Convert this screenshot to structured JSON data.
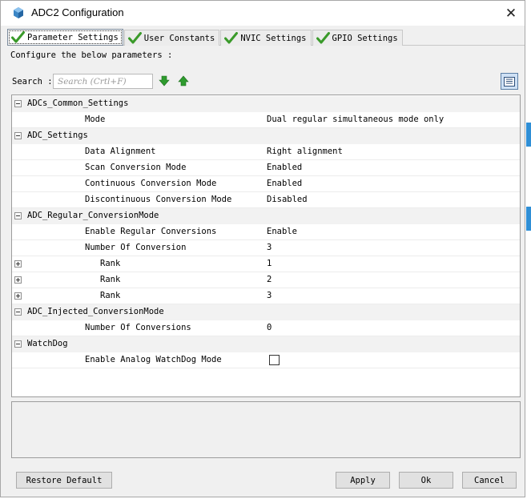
{
  "window": {
    "title": "ADC2 Configuration",
    "close_glyph": "✕"
  },
  "tabs": [
    {
      "label": "Parameter Settings",
      "active": true,
      "icon": "check-icon"
    },
    {
      "label": "User Constants",
      "active": false,
      "icon": "check-icon"
    },
    {
      "label": "NVIC Settings",
      "active": false,
      "icon": "check-icon"
    },
    {
      "label": "GPIO Settings",
      "active": false,
      "icon": "check-icon"
    }
  ],
  "panel": {
    "instruction": "Configure the below parameters :",
    "search_label": "Search :",
    "search_placeholder": "Search (Crtl+F)"
  },
  "parameters": {
    "common": {
      "title": "ADCs_Common_Settings",
      "mode": {
        "label": "Mode",
        "value": "Dual regular simultaneous mode only"
      }
    },
    "adc": {
      "title": "ADC_Settings",
      "data_alignment": {
        "label": "Data Alignment",
        "value": "Right alignment"
      },
      "scan_mode": {
        "label": "Scan Conversion Mode",
        "value": "Enabled"
      },
      "continuous_mode": {
        "label": "Continuous Conversion Mode",
        "value": "Enabled"
      },
      "discontinuous_mode": {
        "label": "Discontinuous Conversion Mode",
        "value": "Disabled"
      }
    },
    "regular": {
      "title": "ADC_Regular_ConversionMode",
      "enable_regular": {
        "label": "Enable Regular Conversions",
        "value": "Enable"
      },
      "num_conversion": {
        "label": "Number Of Conversion",
        "value": "3"
      },
      "ranks": [
        {
          "label": "Rank",
          "value": "1"
        },
        {
          "label": "Rank",
          "value": "2"
        },
        {
          "label": "Rank",
          "value": "3"
        }
      ]
    },
    "injected": {
      "title": "ADC_Injected_ConversionMode",
      "num_conversions": {
        "label": "Number Of Conversions",
        "value": "0"
      }
    },
    "watchdog": {
      "title": "WatchDog",
      "enable_analog": {
        "label": "Enable Analog WatchDog Mode",
        "checked": false
      }
    }
  },
  "buttons": {
    "restore_default": "Restore Default",
    "apply": "Apply",
    "ok": "Ok",
    "cancel": "Cancel"
  },
  "colors": {
    "check_green": "#3a9a2a",
    "arrow_green": "#2e9b2e",
    "title_icon_blue": "#3b86c6",
    "strip_blue": "#2f8fd6"
  }
}
